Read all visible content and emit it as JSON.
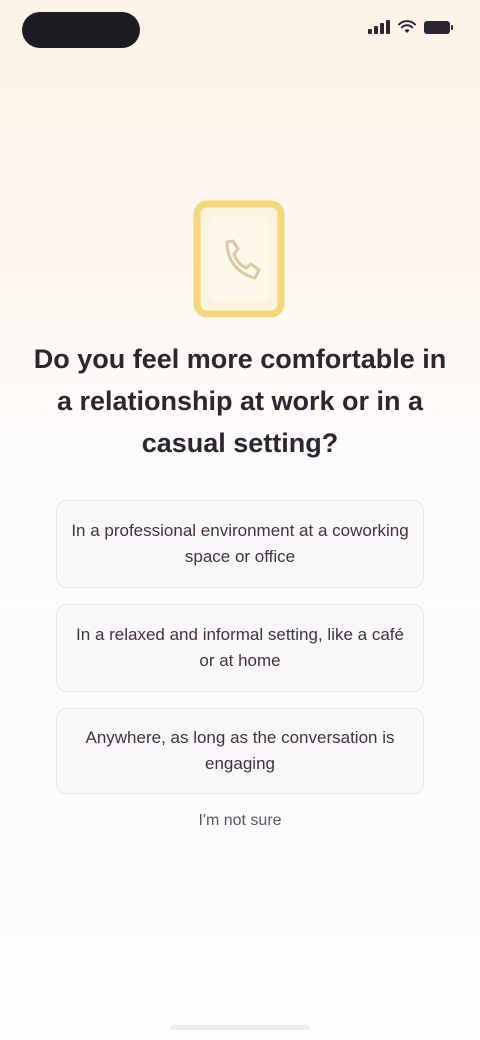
{
  "screen": {
    "title": "Do you feel more comfortable in a relationship at work or in a casual setting?"
  },
  "options": [
    {
      "label": "In a professional environment at a coworking space or office"
    },
    {
      "label": "In a relaxed and informal setting, like a café or at home"
    },
    {
      "label": "Anywhere, as long as the conversation is engaging"
    }
  ],
  "footer": {
    "skip_label": "I'm not sure"
  },
  "colors": {
    "accent_yellow": "#f3d77c",
    "text_dark": "#2b2730"
  },
  "icons": {
    "hero": "phone-card-icon"
  }
}
